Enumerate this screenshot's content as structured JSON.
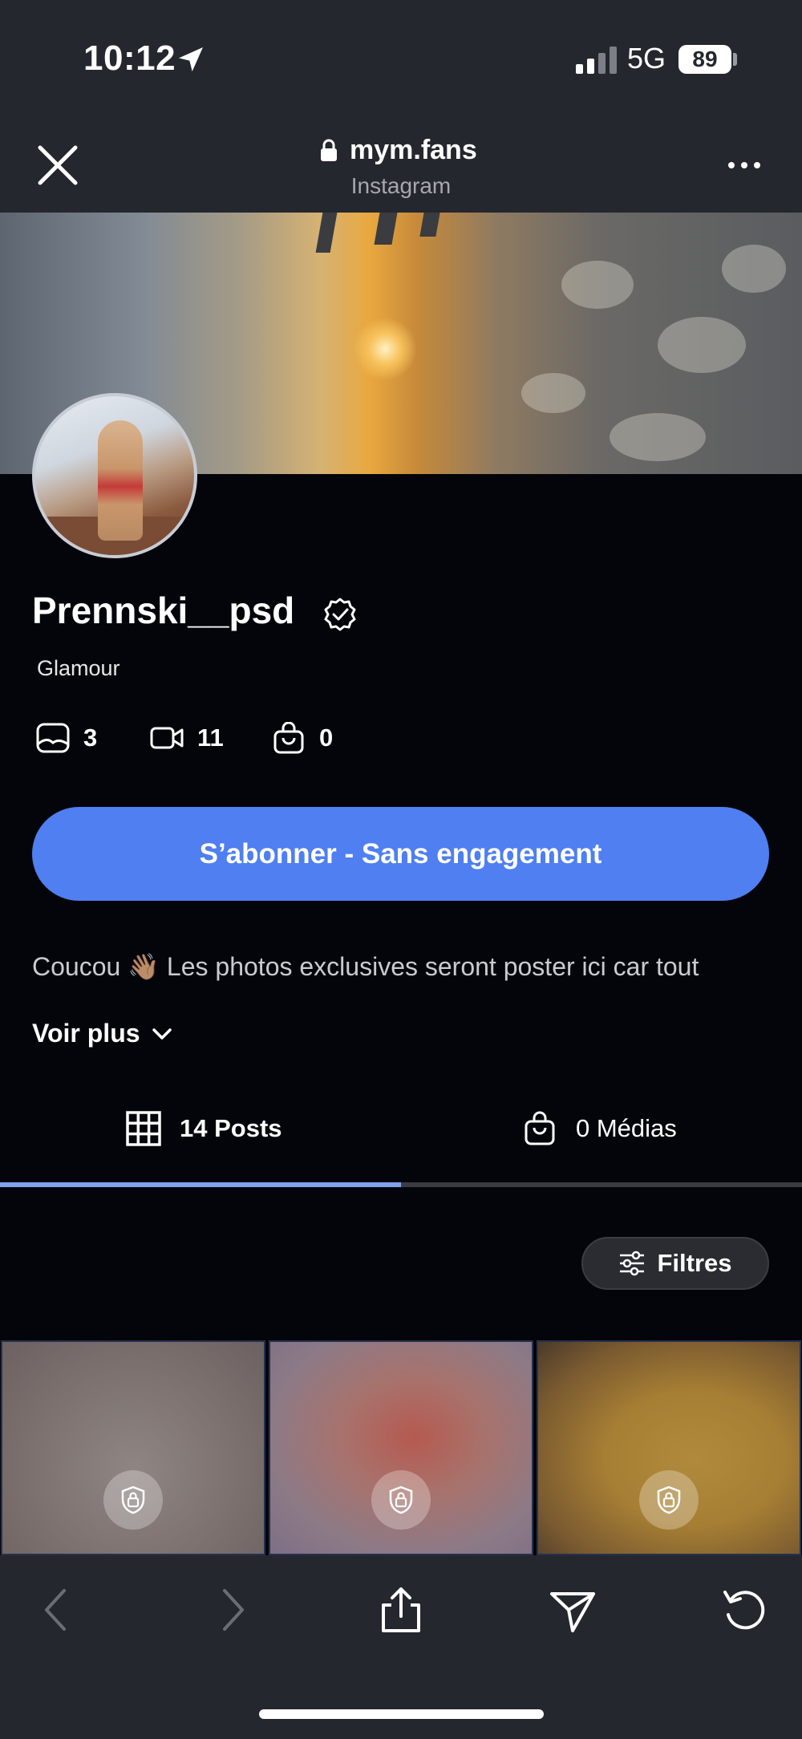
{
  "status_bar": {
    "time": "10:12",
    "network": "5G",
    "battery": "89"
  },
  "browser": {
    "url": "mym.fans",
    "source": "Instagram"
  },
  "profile": {
    "username": "Prennski__psd",
    "category": "Glamour",
    "stats": {
      "photos": "3",
      "videos": "11",
      "shop": "0"
    },
    "subscribe_label": "S’abonner - Sans engagement",
    "bio": "Coucou 👋🏽 Les photos exclusives seront poster ici car tout",
    "see_more_label": "Voir plus"
  },
  "tabs": [
    {
      "label": "14 Posts",
      "icon": "grid-icon",
      "active": true
    },
    {
      "label": "0 Médias",
      "icon": "bag-icon",
      "active": false
    }
  ],
  "filters_label": "Filtres",
  "colors": {
    "accent": "#4f7ff0",
    "active_tab": "#7fa1ef",
    "background": "#04050a",
    "chrome": "#24272e"
  }
}
